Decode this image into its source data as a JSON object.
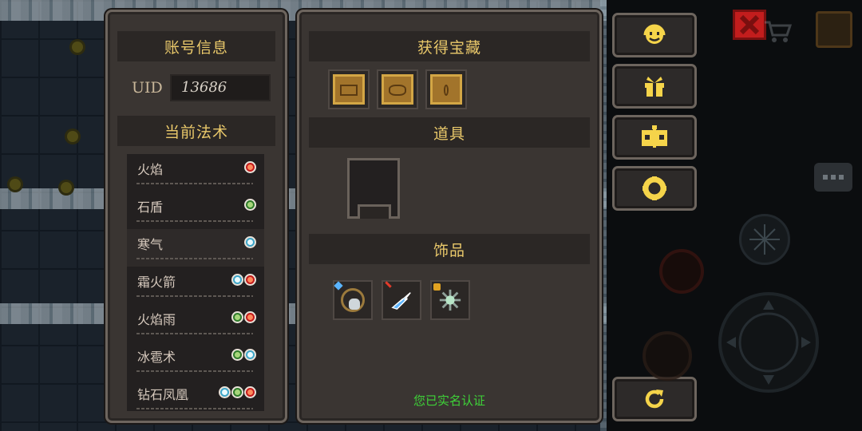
{
  "account_panel": {
    "title": "账号信息",
    "uid_label": "UID",
    "uid_value": "13686",
    "spells_title": "当前法术",
    "spells": [
      {
        "name": "火焰",
        "elements": [
          "fire"
        ]
      },
      {
        "name": "石盾",
        "elements": [
          "earth"
        ]
      },
      {
        "name": "寒气",
        "elements": [
          "ice"
        ]
      },
      {
        "name": "霜火箭",
        "elements": [
          "ice",
          "fire"
        ]
      },
      {
        "name": "火焰雨",
        "elements": [
          "earth",
          "fire"
        ]
      },
      {
        "name": "冰雹术",
        "elements": [
          "earth",
          "ice"
        ]
      },
      {
        "name": "钻石凤凰",
        "elements": [
          "ice",
          "earth",
          "fire"
        ]
      }
    ]
  },
  "inventory_panel": {
    "treasure_title": "获得宝藏",
    "treasures": [
      "treasure-chest-icon",
      "treasure-chest-icon",
      "treasure-chest-icon"
    ],
    "items_title": "道具",
    "accessories_title": "饰品",
    "accessories": [
      "skull-necklace-icon",
      "lightning-wing-icon",
      "spiked-orb-icon"
    ],
    "verified_text": "您已实名认证",
    "verified_color": "#3ed338"
  },
  "side_buttons": [
    {
      "icon": "smiley-headset-icon"
    },
    {
      "icon": "gift-icon"
    },
    {
      "icon": "handbook-icon"
    },
    {
      "icon": "settings-gear-icon"
    },
    {
      "icon": "refresh-icon"
    }
  ],
  "colors": {
    "panel_bg": "#3a3532",
    "header_text": "#e9c86a",
    "accent_yellow": "#f5d44a",
    "close_red": "#c21d1d"
  }
}
